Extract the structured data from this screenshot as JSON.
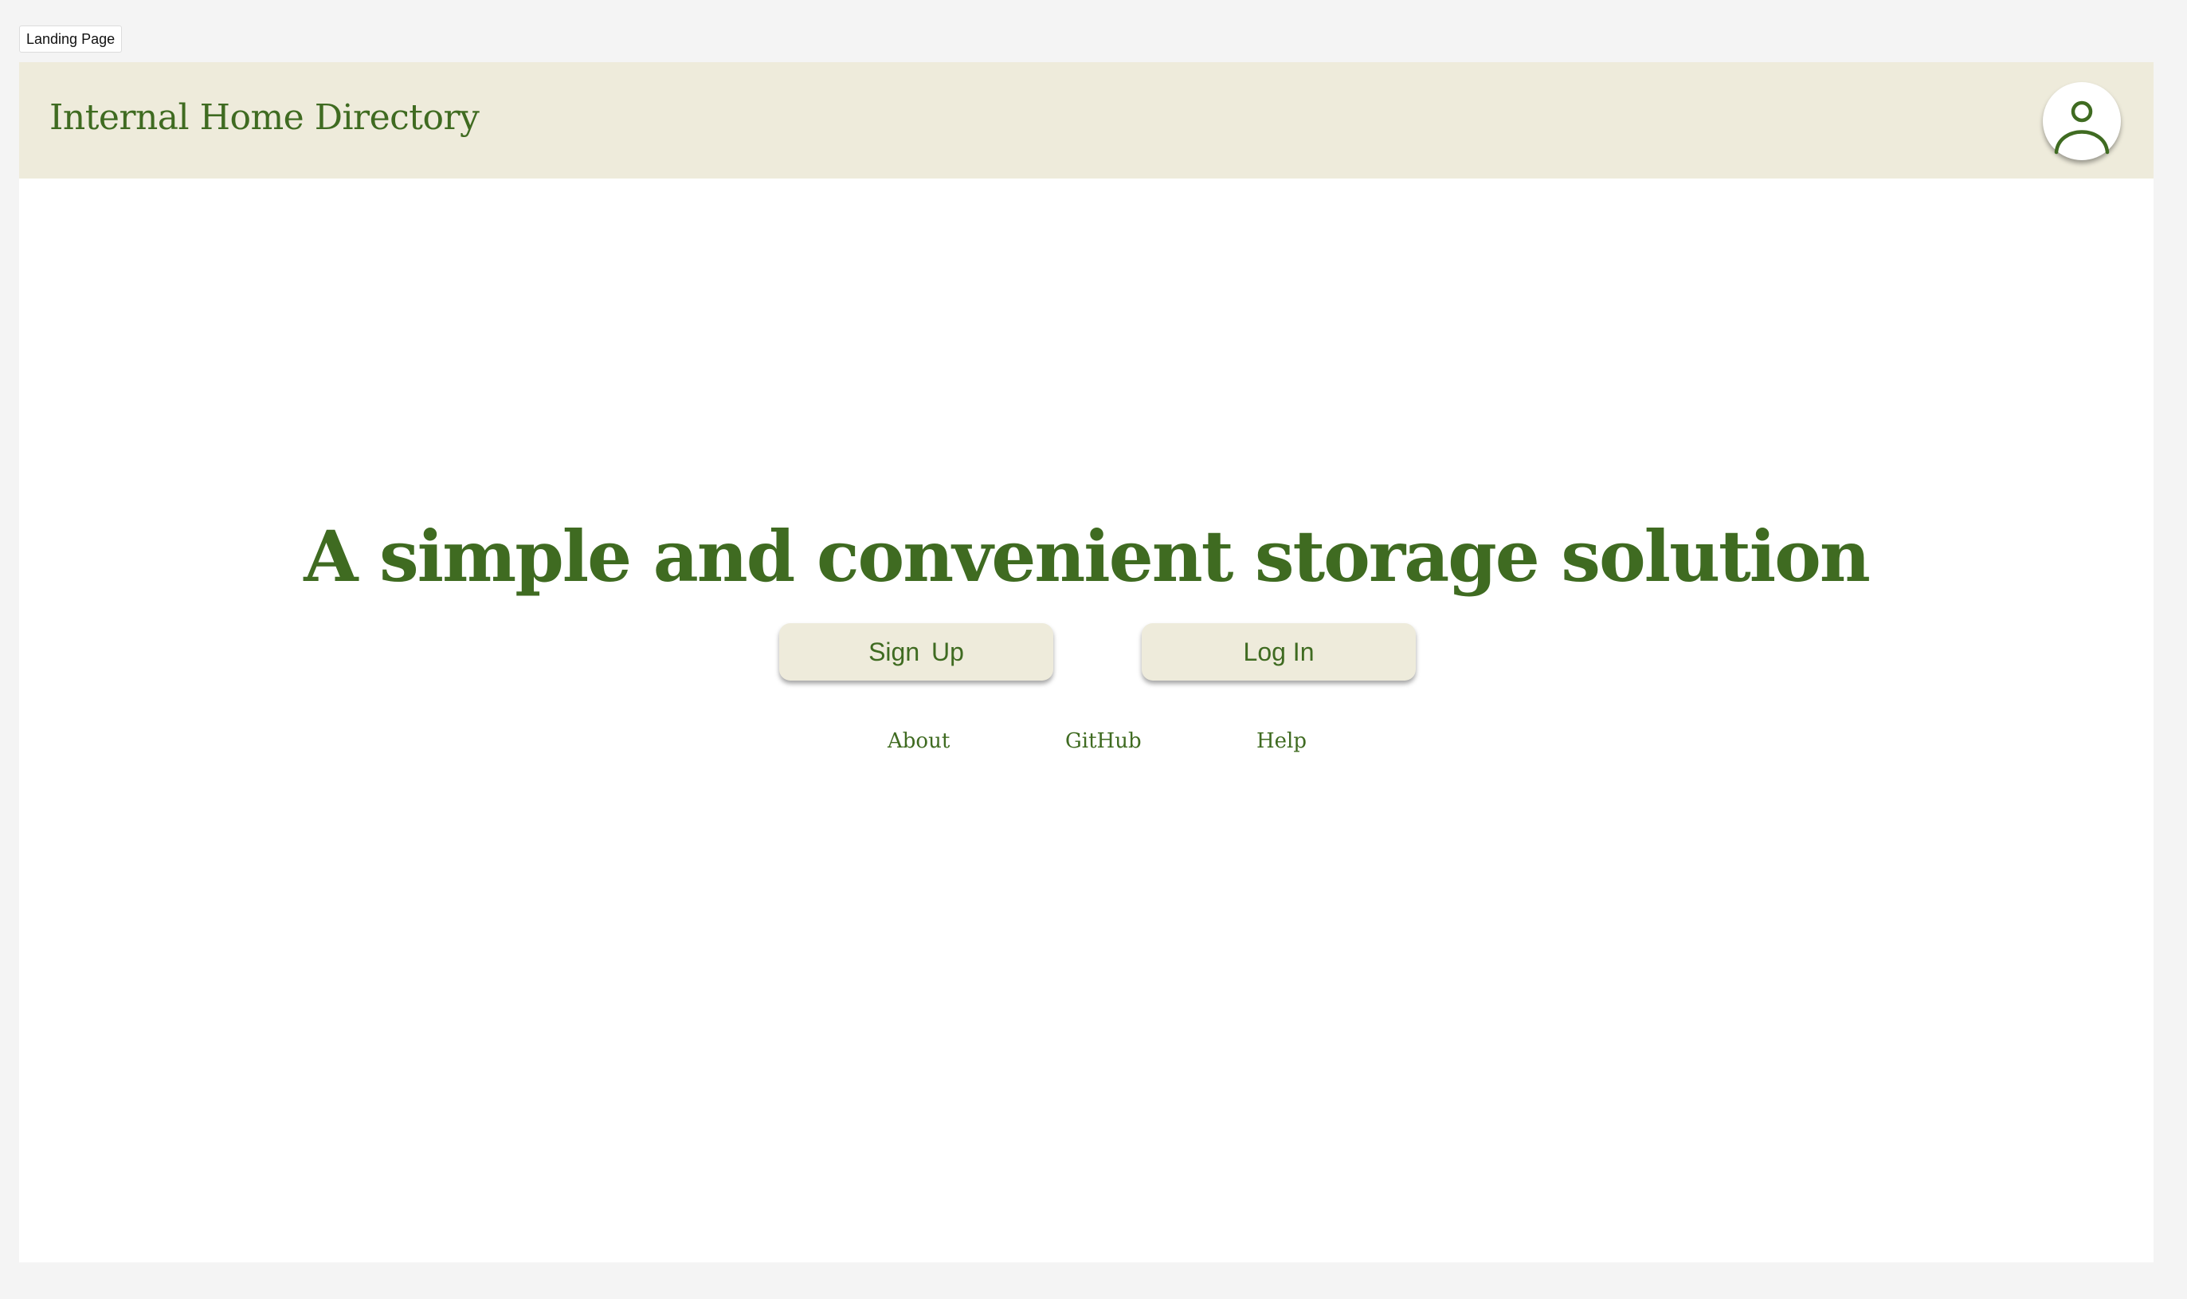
{
  "frame_label": "Landing Page",
  "header": {
    "title": "Internal Home Directory",
    "profile_icon": "user-avatar-icon"
  },
  "hero": {
    "headline": "A simple and convenient storage solution",
    "signup_label": "Sign  Up",
    "login_label": "Log In"
  },
  "footer_links": {
    "about": "About",
    "github": "GitHub",
    "help": "Help"
  },
  "colors": {
    "brand_green": "#3f6b21",
    "header_bg": "#eeebdb",
    "button_bg": "#eeebdb",
    "page_bg": "#ffffff",
    "canvas_bg": "#f4f4f4"
  }
}
